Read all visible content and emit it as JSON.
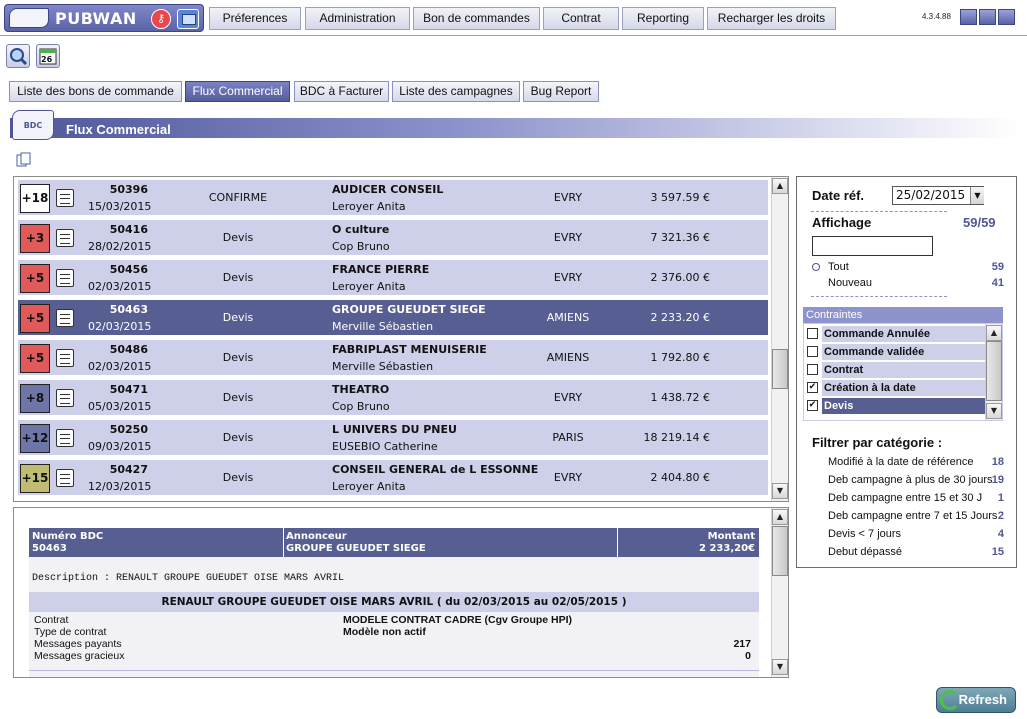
{
  "app": {
    "name": "PUBWAN",
    "version": "4.3.4.88"
  },
  "topnav": [
    "Préferences",
    "Administration",
    "Bon de commandes",
    "Contrat",
    "Reporting",
    "Recharger les droits"
  ],
  "subtabs": [
    "Liste des bons de commande",
    "Flux Commercial",
    "BDC à Facturer",
    "Liste des campagnes",
    "Bug Report"
  ],
  "active_subtab": "Flux Commercial",
  "section": {
    "badge": "BDC",
    "title": "Flux Commercial"
  },
  "toolbar": {
    "calendar_day": "26"
  },
  "orders": [
    {
      "badge": "+18",
      "badge_color": "#ffffff",
      "number": "50396",
      "date": "15/03/2015",
      "status": "CONFIRME",
      "client": "AUDICER CONSEIL",
      "contact": "Leroyer Anita",
      "city": "EVRY",
      "amount": "3 597.59 €"
    },
    {
      "badge": "+3",
      "badge_color": "#e05a5a",
      "number": "50416",
      "date": "28/02/2015",
      "status": "Devis",
      "client": "O culture",
      "contact": "Cop Bruno",
      "city": "EVRY",
      "amount": "7 321.36 €"
    },
    {
      "badge": "+5",
      "badge_color": "#e05a5a",
      "number": "50456",
      "date": "02/03/2015",
      "status": "Devis",
      "client": "FRANCE PIERRE",
      "contact": "Leroyer Anita",
      "city": "EVRY",
      "amount": "2 376.00 €"
    },
    {
      "badge": "+5",
      "badge_color": "#e05a5a",
      "number": "50463",
      "date": "02/03/2015",
      "status": "Devis",
      "client": "GROUPE GUEUDET SIEGE",
      "contact": "Merville Sébastien",
      "city": "AMIENS",
      "amount": "2 233.20 €"
    },
    {
      "badge": "+5",
      "badge_color": "#e05a5a",
      "number": "50486",
      "date": "02/03/2015",
      "status": "Devis",
      "client": "FABRIPLAST MENUISERIE",
      "contact": "Merville Sébastien",
      "city": "AMIENS",
      "amount": "1 792.80 €"
    },
    {
      "badge": "+8",
      "badge_color": "#6e76a8",
      "number": "50471",
      "date": "05/03/2015",
      "status": "Devis",
      "client": "THEATRO",
      "contact": "Cop Bruno",
      "city": "EVRY",
      "amount": "1 438.72 €"
    },
    {
      "badge": "+12",
      "badge_color": "#6e76a8",
      "number": "50250",
      "date": "09/03/2015",
      "status": "Devis",
      "client": "L UNIVERS DU PNEU",
      "contact": "EUSEBIO Catherine",
      "city": "PARIS",
      "amount": "18 219.14 €"
    },
    {
      "badge": "+15",
      "badge_color": "#c0bc72",
      "number": "50427",
      "date": "12/03/2015",
      "status": "Devis",
      "client": "CONSEIL GENERAL de L ESSONNE",
      "contact": "Leroyer Anita",
      "city": "EVRY",
      "amount": "2 404.80 €"
    }
  ],
  "selected_order_index": 3,
  "detail": {
    "head_labels": {
      "number": "Numéro BDC",
      "advertiser": "Annonceur",
      "amount": "Montant"
    },
    "number": "50463",
    "advertiser": "GROUPE GUEUDET SIEGE",
    "amount": "2 233,20€",
    "description": "Description : RENAULT GROUPE GUEUDET OISE MARS AVRIL",
    "campaign": "RENAULT GROUPE GUEUDET OISE MARS AVRIL ( du 02/03/2015 au 02/05/2015 )",
    "fields": [
      {
        "label": "Contrat",
        "value": "MODELE CONTRAT CADRE (Cgv Groupe HPI)",
        "num": ""
      },
      {
        "label": "Type de contrat",
        "value": "Modèle non actif",
        "num": ""
      },
      {
        "label": "Messages payants",
        "value": "",
        "num": "217"
      },
      {
        "label": "Messages gracieux",
        "value": "",
        "num": "0"
      }
    ]
  },
  "side": {
    "date_ref_label": "Date réf.",
    "date_ref_value": "25/02/2015",
    "affichage_label": "Affichage",
    "affichage_count": "59/59",
    "tout_label": "Tout",
    "tout_count": "59",
    "nouveau_label": "Nouveau",
    "nouveau_count": "41",
    "constraints_title": "Contraintes",
    "constraints": [
      {
        "label": "Commande Annulée",
        "checked": false
      },
      {
        "label": "Commande validée",
        "checked": false
      },
      {
        "label": "Contrat",
        "checked": false
      },
      {
        "label": "Création à la date",
        "checked": true
      },
      {
        "label": "Devis",
        "checked": true
      }
    ],
    "filter_title": "Filtrer par catégorie :",
    "categories": [
      {
        "label": "Modifié à la date de référence",
        "count": "18"
      },
      {
        "label": "Deb campagne à plus de 30 jours",
        "count": "19"
      },
      {
        "label": "Deb campagne entre 15 et 30 J",
        "count": "1"
      },
      {
        "label": "Deb campagne entre 7 et 15 Jours",
        "count": "2"
      },
      {
        "label": "Devis < 7 jours",
        "count": "4"
      },
      {
        "label": "Debut dépassé",
        "count": "15"
      }
    ]
  },
  "refresh_label": "Refresh"
}
